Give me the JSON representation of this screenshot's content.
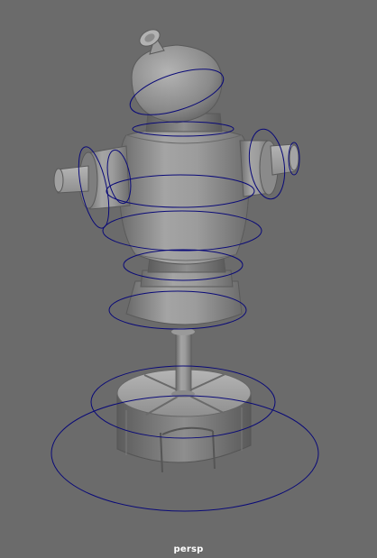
{
  "viewport": {
    "camera_name": "persp",
    "background_color": "#6b6b6b",
    "mesh_color": "#9a9a9a",
    "mesh_shadow_color": "#5e5e5e",
    "control_curve_color": "#0a0a78"
  }
}
